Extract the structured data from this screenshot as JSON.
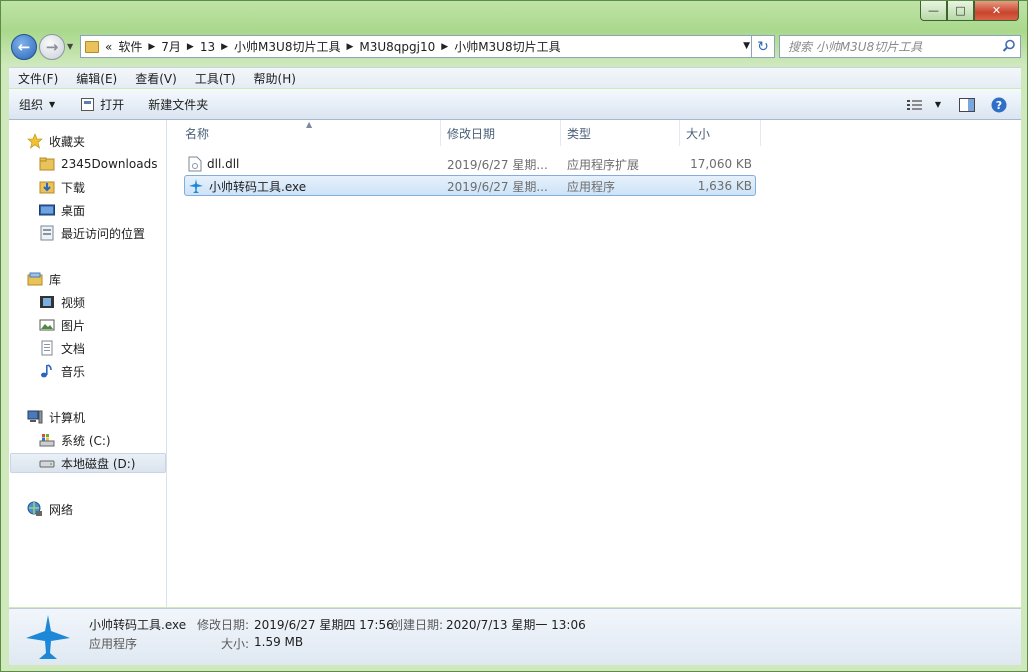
{
  "window": {
    "controls": {
      "minimize": "—",
      "maximize": "□",
      "close": "✕"
    }
  },
  "address": {
    "overflow": "«",
    "crumbs": [
      "软件",
      "7月",
      "13",
      "小帅M3U8切片工具",
      "M3U8qpgj10",
      "小帅M3U8切片工具"
    ],
    "search_placeholder": "搜索 小帅M3U8切片工具"
  },
  "menubar": [
    "文件(F)",
    "编辑(E)",
    "查看(V)",
    "工具(T)",
    "帮助(H)"
  ],
  "toolbar": {
    "organize": "组织",
    "open": "打开",
    "new_folder": "新建文件夹"
  },
  "nav": {
    "favorites": {
      "label": "收藏夹",
      "items": [
        "2345Downloads",
        "下载",
        "桌面",
        "最近访问的位置"
      ]
    },
    "libraries": {
      "label": "库",
      "items": [
        "视频",
        "图片",
        "文档",
        "音乐"
      ]
    },
    "computer": {
      "label": "计算机",
      "items": [
        "系统 (C:)",
        "本地磁盘 (D:)"
      ]
    },
    "network": {
      "label": "网络"
    }
  },
  "columns": [
    "名称",
    "修改日期",
    "类型",
    "大小"
  ],
  "files": [
    {
      "name": "dll.dll",
      "modified": "2019/6/27 星期...",
      "type": "应用程序扩展",
      "size": "17,060 KB"
    },
    {
      "name": "小帅转码工具.exe",
      "modified": "2019/6/27 星期...",
      "type": "应用程序",
      "size": "1,636 KB"
    }
  ],
  "details": {
    "name": "小帅转码工具.exe",
    "type": "应用程序",
    "modified_label": "修改日期:",
    "modified": "2019/6/27 星期四 17:56",
    "created_label": "创建日期:",
    "created": "2020/7/13 星期一 13:06",
    "size_label": "大小:",
    "size": "1.59 MB"
  },
  "colors": {
    "frame": "#a9d88c",
    "selection": "#cde3f8",
    "link_blue": "#2d66b8"
  }
}
